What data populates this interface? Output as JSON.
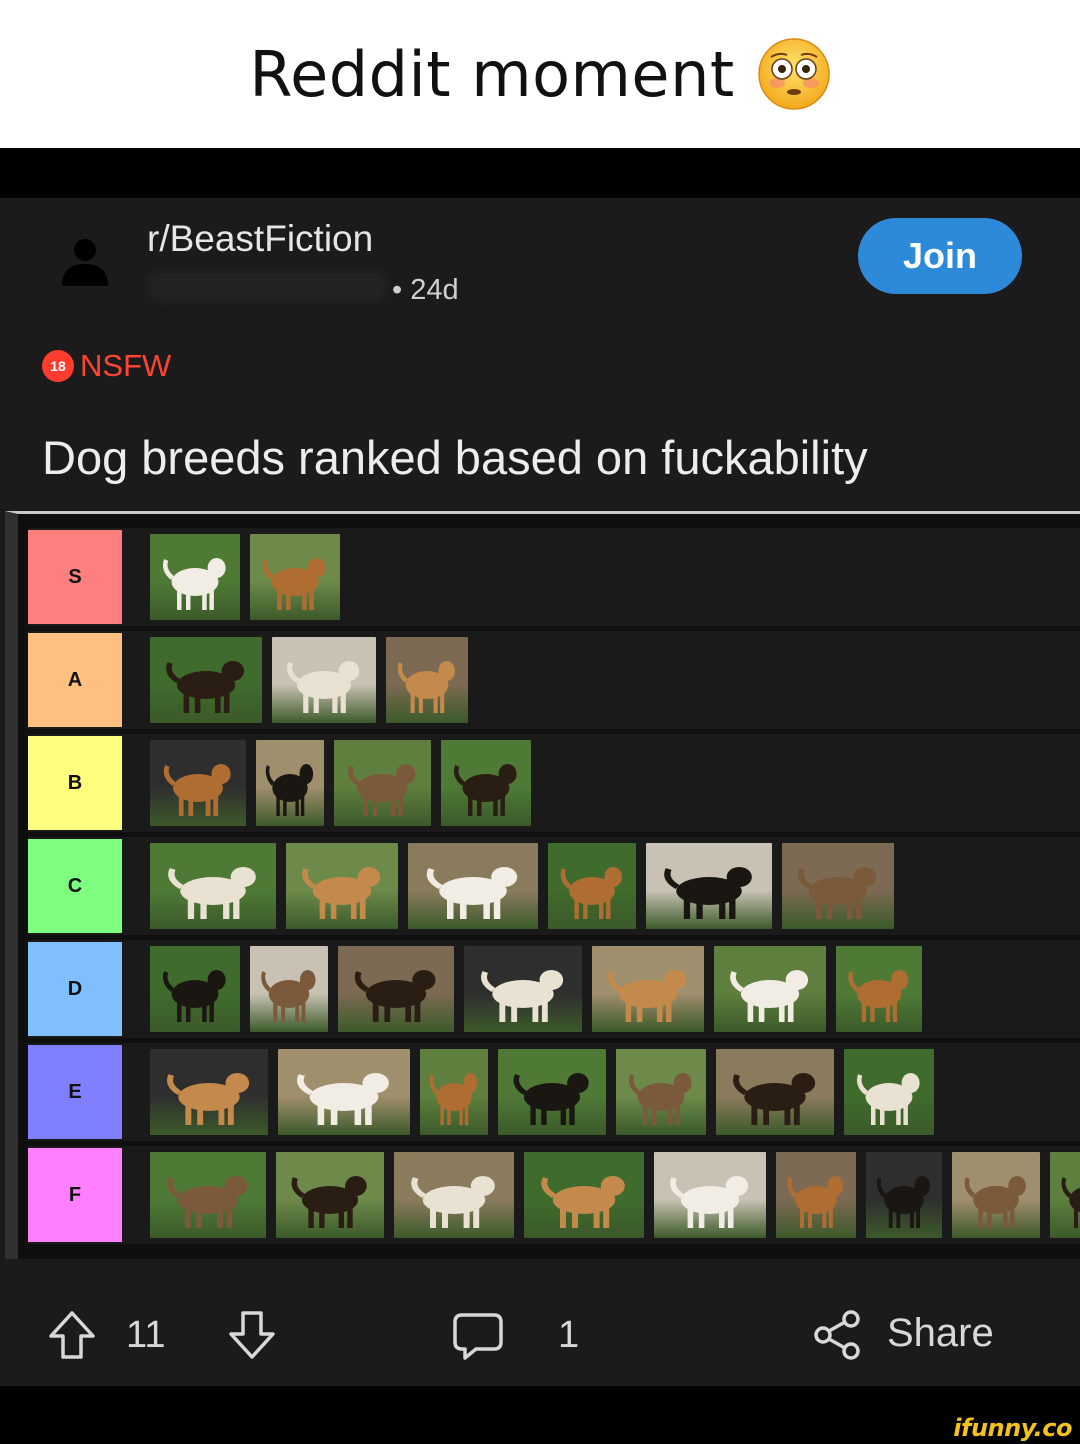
{
  "caption": {
    "text": "Reddit moment",
    "emoji": "flushed-face"
  },
  "post": {
    "subreddit": "r/BeastFiction",
    "age": "• 24d",
    "join_label": "Join",
    "nsfw_badge": "18",
    "nsfw_label": "NSFW",
    "title": "Dog breeds ranked based on fuckability"
  },
  "tierlist": {
    "tiers": [
      {
        "label": "S",
        "color": "#ff7f7f",
        "count": 2
      },
      {
        "label": "A",
        "color": "#ffbf7f",
        "count": 3
      },
      {
        "label": "B",
        "color": "#ffff7f",
        "count": 4
      },
      {
        "label": "C",
        "color": "#7fff7f",
        "count": 6
      },
      {
        "label": "D",
        "color": "#7fbfff",
        "count": 7
      },
      {
        "label": "E",
        "color": "#7f7fff",
        "count": 7
      },
      {
        "label": "F",
        "color": "#ff7fff",
        "count": 9
      }
    ]
  },
  "actions": {
    "upvote_count": "11",
    "comment_count": "1",
    "share_label": "Share"
  },
  "watermark": "ifunny.co"
}
